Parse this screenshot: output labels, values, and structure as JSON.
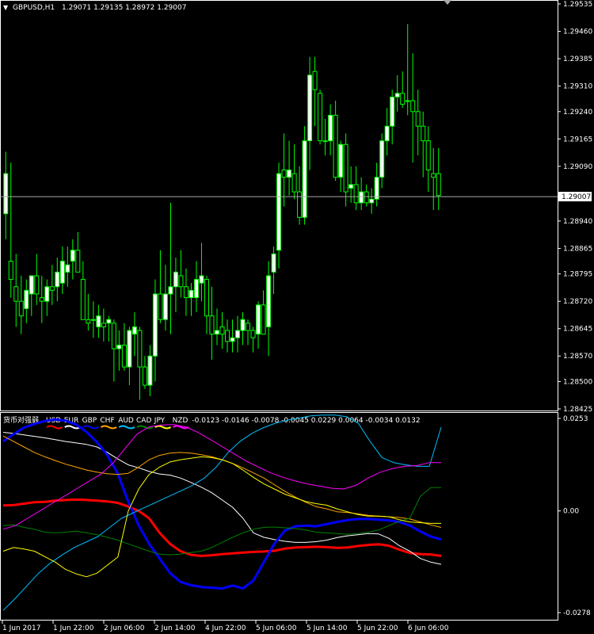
{
  "window": {
    "symbol_label": "GBPUSD,H1",
    "ohlc": "1.29071 1.29135 1.28972 1.29007",
    "current_price": "1.29007"
  },
  "colors": {
    "background": "#000000",
    "bull_candle": "#ffffff",
    "candle_wick": "#00ff00",
    "price_line": "#a9a9a9",
    "axis": "#ffffff"
  },
  "price_axis": {
    "ticks": [
      "1.29535",
      "1.29460",
      "1.29385",
      "1.29310",
      "1.29240",
      "1.29165",
      "1.29090",
      "1.28940",
      "1.28865",
      "1.28795",
      "1.28720",
      "1.28645",
      "1.28570",
      "1.28500",
      "1.28425"
    ]
  },
  "indicator": {
    "title": "货币对强弱",
    "values_text": "-0.0123 -0.0146 -0.0078 -0.0045 0.0229 0.0064 -0.0034 0.0132",
    "currencies": [
      {
        "name": "USD",
        "color": "#ff0000"
      },
      {
        "name": "EUR",
        "color": "#ffffff"
      },
      {
        "name": "GBP",
        "color": "#0000ff"
      },
      {
        "name": "CHF",
        "color": "#ffa500"
      },
      {
        "name": "AUD",
        "color": "#00bfff"
      },
      {
        "name": "CAD",
        "color": "#008000"
      },
      {
        "name": "JPY",
        "color": "#ffff00"
      },
      {
        "name": "NZD",
        "color": "#ff00ff"
      }
    ],
    "axis_ticks": [
      "0.0253",
      "0.00",
      "-0.0278"
    ]
  },
  "time_axis": {
    "labels": [
      "1 Jun 2017",
      "1 Jun 22:00",
      "2 Jun 06:00",
      "2 Jun 14:00",
      "4 Jun 22:00",
      "5 Jun 06:00",
      "5 Jun 14:00",
      "5 Jun 22:00",
      "6 Jun 06:00"
    ]
  },
  "chart_data": {
    "type": "candlestick",
    "price_ylim": [
      1.28425,
      1.29535
    ],
    "candles": [
      [
        1.2896,
        1.2913,
        1.2889,
        1.2907
      ],
      [
        1.2883,
        1.291,
        1.2873,
        1.2878
      ],
      [
        1.2876,
        1.2885,
        1.2865,
        1.2872
      ],
      [
        1.2872,
        1.2879,
        1.2863,
        1.2868
      ],
      [
        1.287,
        1.2878,
        1.2866,
        1.2875
      ],
      [
        1.2874,
        1.2879,
        1.2868,
        1.2879
      ],
      [
        1.2879,
        1.2885,
        1.2871,
        1.2874
      ],
      [
        1.2873,
        1.2879,
        1.2866,
        1.2872
      ],
      [
        1.2872,
        1.2878,
        1.2868,
        1.2876
      ],
      [
        1.2876,
        1.2882,
        1.2871,
        1.2875
      ],
      [
        1.2876,
        1.2884,
        1.2872,
        1.288
      ],
      [
        1.2877,
        1.2887,
        1.2874,
        1.2883
      ],
      [
        1.288,
        1.2887,
        1.2876,
        1.2882
      ],
      [
        1.2883,
        1.2889,
        1.2878,
        1.2886
      ],
      [
        1.2886,
        1.2891,
        1.288,
        1.288
      ],
      [
        1.2878,
        1.2883,
        1.2867,
        1.2867
      ],
      [
        1.2867,
        1.2874,
        1.2864,
        1.2866
      ],
      [
        1.2867,
        1.2872,
        1.2862,
        1.2867
      ],
      [
        1.2865,
        1.2871,
        1.2862,
        1.2868
      ],
      [
        1.2866,
        1.287,
        1.2861,
        1.2865
      ],
      [
        1.2866,
        1.2868,
        1.2861,
        1.2867
      ],
      [
        1.2866,
        1.2867,
        1.285,
        1.2859
      ],
      [
        1.2859,
        1.2864,
        1.2853,
        1.286
      ],
      [
        1.286,
        1.2866,
        1.2853,
        1.2854
      ],
      [
        1.2854,
        1.2865,
        1.2849,
        1.2864
      ],
      [
        1.2863,
        1.2869,
        1.2857,
        1.2865
      ],
      [
        1.2864,
        1.2865,
        1.2845,
        1.2854
      ],
      [
        1.2854,
        1.2857,
        1.2848,
        1.2849
      ],
      [
        1.2849,
        1.286,
        1.2846,
        1.2857
      ],
      [
        1.2857,
        1.2878,
        1.285,
        1.2874
      ],
      [
        1.2874,
        1.2886,
        1.2866,
        1.2867
      ],
      [
        1.2867,
        1.2882,
        1.2864,
        1.2874
      ],
      [
        1.2874,
        1.2899,
        1.2863,
        1.2876
      ],
      [
        1.2876,
        1.2884,
        1.2869,
        1.288
      ],
      [
        1.2879,
        1.2886,
        1.2873,
        1.2876
      ],
      [
        1.2876,
        1.2881,
        1.2868,
        1.2873
      ],
      [
        1.2873,
        1.2877,
        1.2868,
        1.2875
      ],
      [
        1.2873,
        1.2883,
        1.2869,
        1.2878
      ],
      [
        1.2877,
        1.2888,
        1.2872,
        1.2879
      ],
      [
        1.2878,
        1.2879,
        1.2863,
        1.2868
      ],
      [
        1.2868,
        1.2876,
        1.2856,
        1.2863
      ],
      [
        1.2863,
        1.287,
        1.286,
        1.2864
      ],
      [
        1.2865,
        1.2869,
        1.2859,
        1.2863
      ],
      [
        1.2864,
        1.2867,
        1.2858,
        1.2861
      ],
      [
        1.2861,
        1.2867,
        1.2858,
        1.2862
      ],
      [
        1.2862,
        1.2868,
        1.2858,
        1.2864
      ],
      [
        1.2864,
        1.2869,
        1.286,
        1.2867
      ],
      [
        1.2866,
        1.2867,
        1.286,
        1.2864
      ],
      [
        1.2864,
        1.2865,
        1.2858,
        1.2862
      ],
      [
        1.2863,
        1.2872,
        1.2859,
        1.2871
      ],
      [
        1.2871,
        1.2875,
        1.2863,
        1.2863
      ],
      [
        1.2865,
        1.2883,
        1.2857,
        1.2879
      ],
      [
        1.288,
        1.2887,
        1.2874,
        1.2885
      ],
      [
        1.2886,
        1.291,
        1.2881,
        1.2907
      ],
      [
        1.2908,
        1.2918,
        1.2898,
        1.2906
      ],
      [
        1.2906,
        1.2916,
        1.2901,
        1.2908
      ],
      [
        1.2907,
        1.2915,
        1.29,
        1.2902
      ],
      [
        1.2902,
        1.2909,
        1.2893,
        1.2895
      ],
      [
        1.2895,
        1.292,
        1.2893,
        1.2916
      ],
      [
        1.2916,
        1.2939,
        1.2908,
        1.2934
      ],
      [
        1.2935,
        1.2939,
        1.292,
        1.293
      ],
      [
        1.2929,
        1.293,
        1.2915,
        1.2916
      ],
      [
        1.2916,
        1.2922,
        1.2912,
        1.2916
      ],
      [
        1.2916,
        1.2926,
        1.2912,
        1.2923
      ],
      [
        1.2923,
        1.2927,
        1.2905,
        1.2906
      ],
      [
        1.2906,
        1.2916,
        1.2902,
        1.2915
      ],
      [
        1.2915,
        1.2918,
        1.2898,
        1.2902
      ],
      [
        1.2903,
        1.2909,
        1.2899,
        1.2904
      ],
      [
        1.2904,
        1.2909,
        1.2897,
        1.2899
      ],
      [
        1.2899,
        1.2906,
        1.2897,
        1.2902
      ],
      [
        1.2902,
        1.2904,
        1.2898,
        1.2899
      ],
      [
        1.2899,
        1.2903,
        1.2896,
        1.29
      ],
      [
        1.29,
        1.291,
        1.2898,
        1.2906
      ],
      [
        1.2906,
        1.2918,
        1.2903,
        1.2916
      ],
      [
        1.2916,
        1.2925,
        1.2912,
        1.292
      ],
      [
        1.292,
        1.293,
        1.2915,
        1.2928
      ],
      [
        1.2928,
        1.2934,
        1.2924,
        1.2929
      ],
      [
        1.2929,
        1.2935,
        1.2925,
        1.2926
      ],
      [
        1.2927,
        1.2948,
        1.2923,
        1.2927
      ],
      [
        1.2927,
        1.294,
        1.291,
        1.2924
      ],
      [
        1.2924,
        1.293,
        1.2912,
        1.292
      ],
      [
        1.292,
        1.2924,
        1.2906,
        1.2916
      ],
      [
        1.2916,
        1.292,
        1.2902,
        1.2908
      ],
      [
        1.2907,
        1.2914,
        1.2897,
        1.2906
      ],
      [
        1.2907,
        1.2914,
        1.2897,
        1.2901
      ]
    ],
    "indicator_ylim": [
      -0.0278,
      0.0253
    ],
    "strength_series": [
      {
        "name": "USD",
        "color": "#ff0000",
        "width": 3,
        "values": [
          0.0015,
          0.0016,
          0.002,
          0.0024,
          0.0025,
          0.0028,
          0.003,
          0.0031,
          0.003,
          0.0028,
          0.0026,
          0.0022,
          0.0012,
          0.0,
          -0.002,
          -0.006,
          -0.009,
          -0.011,
          -0.012,
          -0.0123,
          -0.0121,
          -0.0118,
          -0.0116,
          -0.0114,
          -0.0112,
          -0.0111,
          -0.0109,
          -0.0103,
          -0.01,
          -0.0099,
          -0.0098,
          -0.0099,
          -0.0101,
          -0.01,
          -0.0096,
          -0.0093,
          -0.0091,
          -0.0095,
          -0.0106,
          -0.0115,
          -0.0118,
          -0.0119,
          -0.0123
        ]
      },
      {
        "name": "EUR",
        "color": "#ffffff",
        "width": 1,
        "values": [
          0.0215,
          0.0212,
          0.0208,
          0.0204,
          0.02,
          0.0195,
          0.019,
          0.0186,
          0.0182,
          0.0175,
          0.016,
          0.0142,
          0.0126,
          0.0118,
          0.0108,
          0.0101,
          0.0098,
          0.009,
          0.0078,
          0.0065,
          0.005,
          0.003,
          0.001,
          -0.002,
          -0.006,
          -0.0072,
          -0.0078,
          -0.0083,
          -0.0086,
          -0.0086,
          -0.0084,
          -0.008,
          -0.0073,
          -0.0068,
          -0.0065,
          -0.0062,
          -0.0063,
          -0.0075,
          -0.0095,
          -0.011,
          -0.013,
          -0.014,
          -0.0146
        ]
      },
      {
        "name": "GBP",
        "color": "#0000ff",
        "width": 3,
        "values": [
          0.019,
          0.021,
          0.0228,
          0.0238,
          0.0246,
          0.025,
          0.0247,
          0.0236,
          0.0216,
          0.0188,
          0.0152,
          0.0102,
          0.0025,
          -0.004,
          -0.009,
          -0.013,
          -0.017,
          -0.0194,
          -0.0203,
          -0.0208,
          -0.021,
          -0.0212,
          -0.0204,
          -0.0212,
          -0.019,
          -0.014,
          -0.009,
          -0.0054,
          -0.0042,
          -0.004,
          -0.0042,
          -0.0036,
          -0.003,
          -0.0025,
          -0.0022,
          -0.0022,
          -0.0024,
          -0.0026,
          -0.003,
          -0.004,
          -0.0056,
          -0.007,
          -0.0078
        ]
      },
      {
        "name": "CHF",
        "color": "#ffa500",
        "width": 1,
        "values": [
          0.0205,
          0.019,
          0.0175,
          0.016,
          0.0148,
          0.0138,
          0.0128,
          0.012,
          0.0112,
          0.0106,
          0.0102,
          0.01,
          0.0103,
          0.012,
          0.014,
          0.0152,
          0.0158,
          0.016,
          0.0158,
          0.0154,
          0.0148,
          0.014,
          0.013,
          0.0118,
          0.0104,
          0.009,
          0.0072,
          0.0054,
          0.0038,
          0.0024,
          0.0012,
          0.0006,
          -0.0002,
          -0.0004,
          -0.0008,
          -0.0012,
          -0.0014,
          -0.0016,
          -0.0018,
          -0.0022,
          -0.003,
          -0.0038,
          -0.0045
        ]
      },
      {
        "name": "AUD",
        "color": "#00bfff",
        "width": 1,
        "values": [
          -0.0272,
          -0.024,
          -0.0205,
          -0.017,
          -0.0142,
          -0.012,
          -0.01,
          -0.0085,
          -0.007,
          -0.0045,
          -0.002,
          -0.0005,
          0.001,
          0.0025,
          0.004,
          0.0055,
          0.007,
          0.009,
          0.012,
          0.016,
          0.019,
          0.0212,
          0.0228,
          0.024,
          0.0248,
          0.0254,
          0.026,
          0.0262,
          0.0262,
          0.0258,
          0.024,
          0.019,
          0.0146,
          0.0132,
          0.0126,
          0.0122,
          0.0122,
          0.0229
        ]
      },
      {
        "name": "CAD",
        "color": "#008000",
        "width": 1,
        "values": [
          -0.004,
          -0.0038,
          -0.0045,
          -0.005,
          -0.0058,
          -0.006,
          -0.0058,
          -0.0055,
          -0.006,
          -0.0065,
          -0.0072,
          -0.008,
          -0.009,
          -0.01,
          -0.011,
          -0.0118,
          -0.012,
          -0.0118,
          -0.0114,
          -0.011,
          -0.01,
          -0.0086,
          -0.0072,
          -0.006,
          -0.005,
          -0.0045,
          -0.0044,
          -0.0046,
          -0.0048,
          -0.0052,
          -0.0058,
          -0.006,
          -0.0062,
          -0.0064,
          -0.0062,
          -0.0058,
          -0.0052,
          -0.004,
          -0.0028,
          -0.002,
          0.004,
          0.0064,
          0.0064
        ]
      },
      {
        "name": "JPY",
        "color": "#ffff00",
        "width": 1,
        "values": [
          -0.011,
          -0.01,
          -0.0104,
          -0.011,
          -0.0125,
          -0.014,
          -0.016,
          -0.0172,
          -0.018,
          -0.017,
          -0.0148,
          -0.0126,
          0.0,
          0.006,
          0.01,
          0.012,
          0.0134,
          0.014,
          0.0144,
          0.0148,
          0.0146,
          0.014,
          0.013,
          0.0112,
          0.0092,
          0.0074,
          0.006,
          0.0046,
          0.0036,
          0.0026,
          0.002,
          0.0016,
          0.0006,
          -0.0002,
          -0.001,
          -0.0014,
          -0.0014,
          -0.0016,
          -0.0024,
          -0.003,
          -0.0032,
          -0.0034,
          -0.0034
        ]
      },
      {
        "name": "NZD",
        "color": "#ff00ff",
        "width": 1,
        "values": [
          -0.005,
          -0.004,
          -0.002,
          0.0,
          0.002,
          0.004,
          0.006,
          0.008,
          0.01,
          0.013,
          0.017,
          0.021,
          0.023,
          0.0235,
          0.0236,
          0.023,
          0.0215,
          0.0196,
          0.0176,
          0.0156,
          0.0136,
          0.012,
          0.0104,
          0.0092,
          0.0082,
          0.0074,
          0.0068,
          0.0062,
          0.006,
          0.007,
          0.009,
          0.0106,
          0.0116,
          0.0122,
          0.0124,
          0.0132,
          0.0132
        ]
      }
    ],
    "x_labels": [
      "1 Jun 2017",
      "1 Jun 22:00",
      "2 Jun 06:00",
      "2 Jun 14:00",
      "4 Jun 22:00",
      "5 Jun 06:00",
      "5 Jun 14:00",
      "5 Jun 22:00",
      "6 Jun 06:00"
    ]
  }
}
